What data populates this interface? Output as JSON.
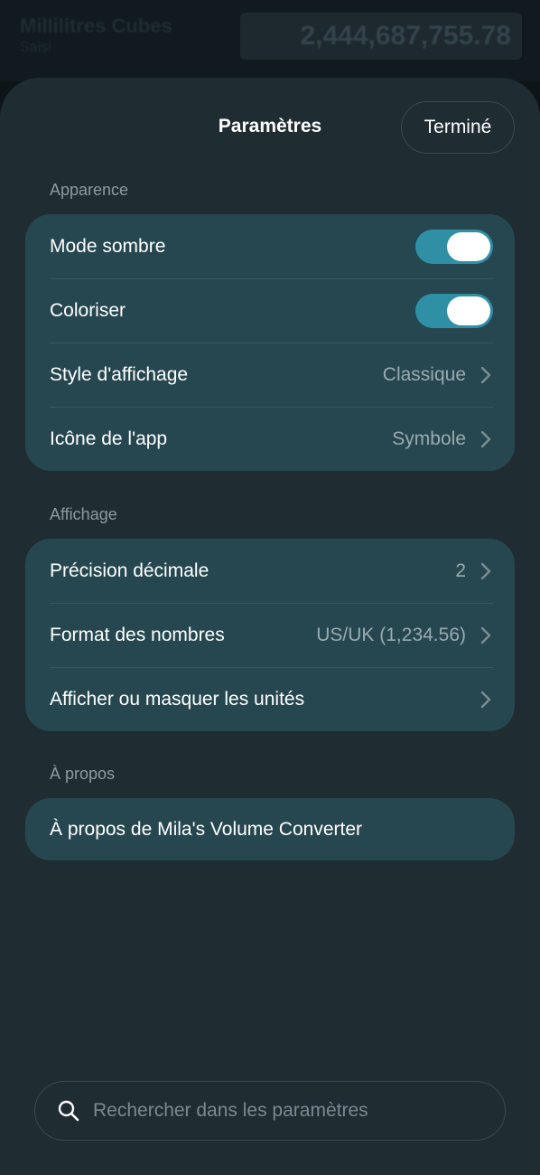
{
  "background": {
    "title": "Millilitres Cubes",
    "subtitle": "Saisi",
    "value": "2,444,687,755.78"
  },
  "sheet": {
    "title": "Paramètres",
    "done_label": "Terminé"
  },
  "sections": {
    "appearance": {
      "label": "Apparence",
      "dark_mode": {
        "label": "Mode sombre",
        "on": true
      },
      "colorize": {
        "label": "Coloriser",
        "on": true
      },
      "display_style": {
        "label": "Style d'affichage",
        "value": "Classique"
      },
      "app_icon": {
        "label": "Icône de l'app",
        "value": "Symbole"
      }
    },
    "display": {
      "label": "Affichage",
      "decimal_precision": {
        "label": "Précision décimale",
        "value": "2"
      },
      "number_format": {
        "label": "Format des nombres",
        "value": "US/UK (1,234.56)"
      },
      "units_visibility": {
        "label": "Afficher ou masquer les unités"
      }
    },
    "about": {
      "label": "À propos",
      "about_app": {
        "label": "À propos de Mila's Volume Converter"
      }
    }
  },
  "search": {
    "placeholder": "Rechercher dans les paramètres",
    "value": ""
  },
  "colors": {
    "accent": "#2f8fa5",
    "card": "#264750",
    "sheet": "#1f2c32"
  },
  "icons": {
    "chevron": "chevron-right-icon",
    "search": "magnifier-icon"
  }
}
